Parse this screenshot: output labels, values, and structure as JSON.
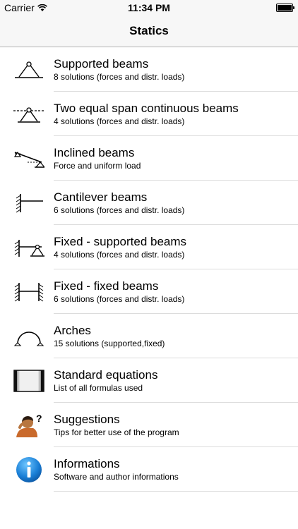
{
  "status_bar": {
    "carrier": "Carrier",
    "time": "11:34 PM"
  },
  "nav": {
    "title": "Statics"
  },
  "items": [
    {
      "title": "Supported beams",
      "subtitle": "8 solutions (forces and distr. loads)",
      "icon": "supported-beam-icon"
    },
    {
      "title": "Two equal span continuous beams",
      "subtitle": "4 solutions (forces and distr. loads)",
      "icon": "continuous-beam-icon"
    },
    {
      "title": "Inclined beams",
      "subtitle": "Force and uniform load",
      "icon": "inclined-beam-icon"
    },
    {
      "title": "Cantilever beams",
      "subtitle": "6 solutions (forces and distr. loads)",
      "icon": "cantilever-beam-icon"
    },
    {
      "title": "Fixed - supported beams",
      "subtitle": "4 solutions (forces and distr. loads)",
      "icon": "fixed-supported-beam-icon"
    },
    {
      "title": "Fixed - fixed beams",
      "subtitle": "6 solutions (forces and distr. loads)",
      "icon": "fixed-fixed-beam-icon"
    },
    {
      "title": "Arches",
      "subtitle": "15 solutions (supported,fixed)",
      "icon": "arch-icon"
    },
    {
      "title": "Standard equations",
      "subtitle": "List of all formulas used",
      "icon": "book-icon"
    },
    {
      "title": "Suggestions",
      "subtitle": "Tips for better use of the program",
      "icon": "thinking-person-icon"
    },
    {
      "title": "Informations",
      "subtitle": "Software and author informations",
      "icon": "info-icon"
    }
  ]
}
